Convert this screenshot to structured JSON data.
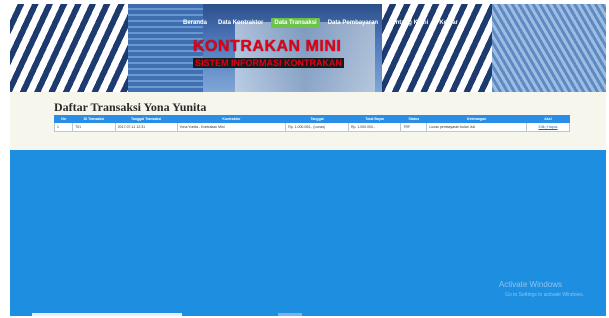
{
  "header": {
    "nav": [
      {
        "label": "Beranda",
        "active": false
      },
      {
        "label": "Data Kontraktor",
        "active": false
      },
      {
        "label": "Data Transaksi",
        "active": true
      },
      {
        "label": "Data Pembayaran",
        "active": false
      },
      {
        "label": "Tentang Kami",
        "active": false
      },
      {
        "label": "Keluar",
        "active": false
      }
    ],
    "logo_title": "KONTRAKAN MINI",
    "logo_subtitle": "SISTEM INFORMASI KONTRAKAN"
  },
  "page": {
    "title": "Daftar Transaksi Yona Yunita"
  },
  "table": {
    "columns": [
      "No",
      "ID Transaksi",
      "Tanggal Transaksi",
      "Kontraktor",
      "Tanggal",
      "Total Bayar",
      "Status",
      "Keterangan",
      "Aksi"
    ],
    "rows": [
      [
        "1",
        "T01",
        "2017-07-11 12:31",
        "Yona Yunita - Kontrakan Mini",
        "Rp. 1.000.000,- (Lunas)",
        "Rp. 1.000.000,-",
        "TRF",
        "Lunas pembayaran bulan Juli",
        "Edit | Hapus"
      ]
    ]
  },
  "watermark": {
    "line1": "Activate Windows",
    "line2": "Go to Settings to activate Windows."
  },
  "colors": {
    "brand_blue": "#1e8fe0",
    "nav_active": "#6cc24a",
    "logo_red": "#e2001a"
  }
}
